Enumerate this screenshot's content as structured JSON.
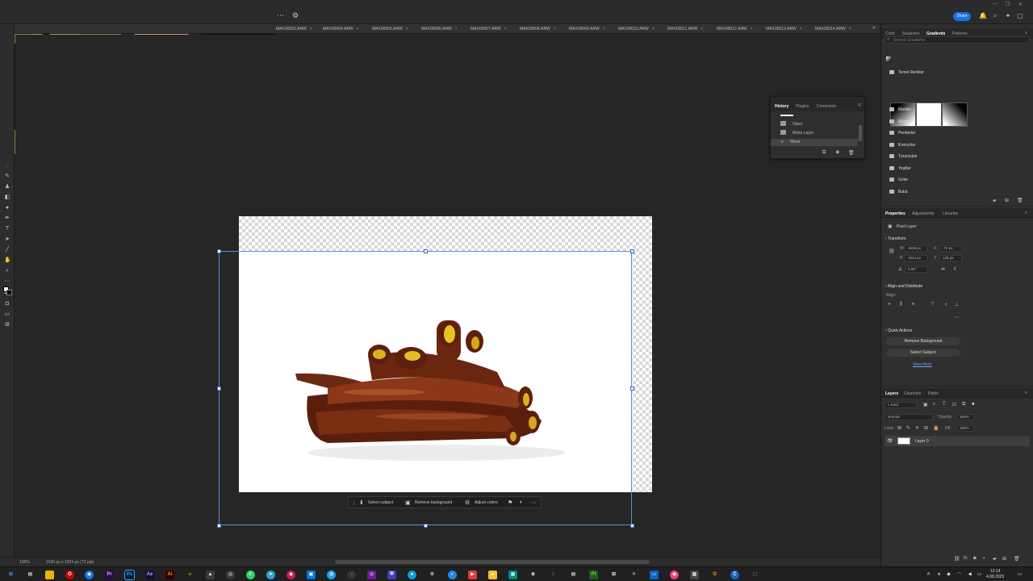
{
  "app": {
    "name": "Photoshop"
  },
  "share_label": "Share",
  "tabs": [
    "MAX00003.ARW",
    "MAX00004.ARW",
    "MAX00005.ARW",
    "MAX00006.ARW",
    "MAX00007.ARW",
    "MAX00008.ARW",
    "MAX00009.ARW",
    "MAX00010.ARW",
    "MAX00011.ARW",
    "MAX00012.ARW",
    "MAX00013.ARW",
    "MAX00014.ARW"
  ],
  "tab_close": "×",
  "context_bar": {
    "select_subject": "Select subject",
    "remove_background": "Remove background",
    "adjust_colors": "Adjust colors"
  },
  "status": {
    "zoom": "100%",
    "doc_size": "1536 px x 1024 px (72 ppi)"
  },
  "gradients_panel": {
    "tabs": [
      "Color",
      "Swatches",
      "Gradients",
      "Patterns"
    ],
    "active_tab": "Gradients",
    "search_placeholder": "Search Gradients",
    "group_open": "Temel Renkler",
    "groups": [
      "Maviler",
      "Morlar",
      "Pembeler",
      "Kırmızılar",
      "Turuncular",
      "Yeşiller",
      "Griler",
      "Bulut"
    ]
  },
  "history_panel": {
    "tabs": [
      "History",
      "Plugins",
      "Comments"
    ],
    "active_tab": "History",
    "items": [
      "Open",
      "Make Layer",
      "Move"
    ],
    "selected": "Move"
  },
  "properties_panel": {
    "tabs": [
      "Properties",
      "Adjustments",
      "Libraries"
    ],
    "active_tab": "Properties",
    "layer_type": "Pixel Layer",
    "transform_title": "Transform",
    "w_label": "W",
    "w_value": "1536 px",
    "h_label": "H",
    "h_value": "1024 px",
    "x_label": "X",
    "x_value": "-72 px",
    "y_label": "Y",
    "y_value": "126 px",
    "angle_value": "0,00°",
    "align_title": "Align and Distribute",
    "align_label": "Align:",
    "quick_actions_title": "Quick Actions",
    "remove_bg": "Remove Background",
    "select_subject": "Select Subject",
    "view_more": "View More"
  },
  "layers_panel": {
    "tabs": [
      "Layers",
      "Channels",
      "Paths"
    ],
    "active_tab": "Layers",
    "kind": "Kind",
    "blend_mode": "Normal",
    "opacity_label": "Opacity:",
    "opacity_value": "100%",
    "lock_label": "Lock:",
    "fill_label": "Fill:",
    "fill_value": "100%",
    "layer_name": "Layer 0"
  },
  "clock": {
    "time": "12:14",
    "date": "4.08.2025"
  },
  "colors": {
    "accent": "#1473e6",
    "selection": "#5b8fd6"
  }
}
